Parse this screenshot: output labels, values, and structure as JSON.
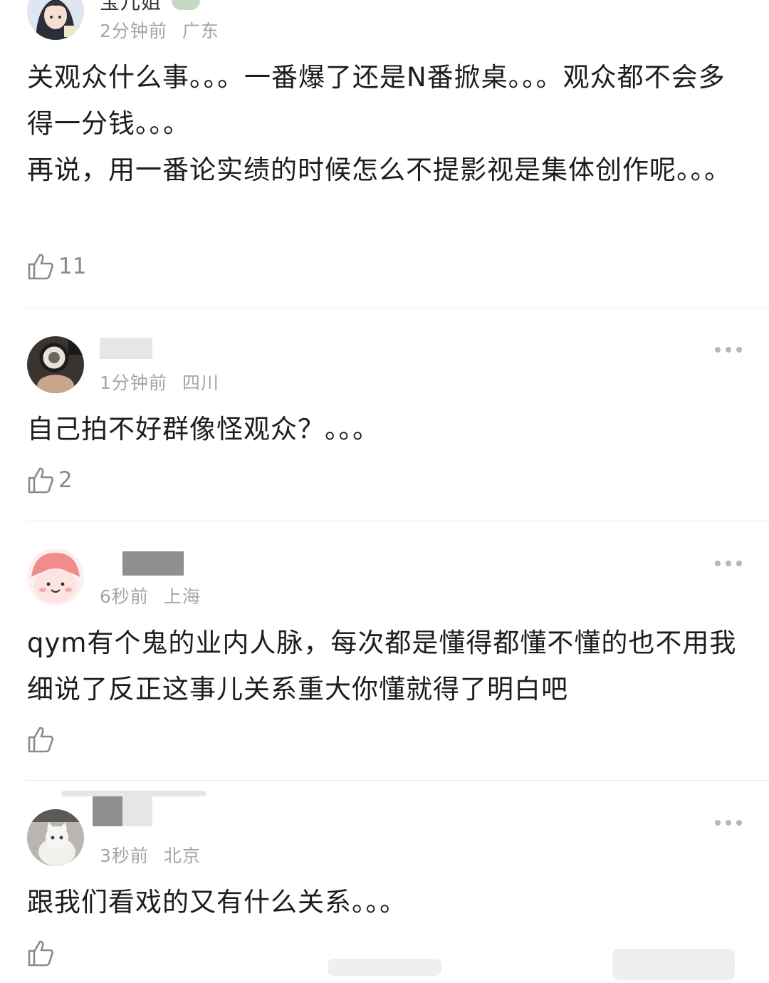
{
  "comments": [
    {
      "avatar": "anime-girl-avatar",
      "username": "宝儿姐",
      "time": "2分钟前",
      "location": "广东",
      "text": "关观众什么事。。。一番爆了还是N番掀桌。。。观众都不会多得一分钱。。。\n再说，用一番论实绩的时候怎么不提影视是集体创作呢。。。",
      "likes": "11"
    },
    {
      "avatar": "photo-avatar",
      "username": "",
      "time": "1分钟前",
      "location": "四川",
      "text": "自己拍不好群像怪观众？。。。",
      "likes": "2"
    },
    {
      "avatar": "cartoon-pink-avatar",
      "username": "",
      "time": "6秒前",
      "location": "上海",
      "text": "qym有个鬼的业内人脉，每次都是懂得都懂不懂的也不用我细说了反正这事儿关系重大你懂就得了明白吧",
      "likes": ""
    },
    {
      "avatar": "cat-photo-avatar",
      "username": "",
      "time": "3秒前",
      "location": "北京",
      "text": "跟我们看戏的又有什么关系。。。",
      "likes": ""
    }
  ],
  "icons": {
    "like": "thumbs-up-icon",
    "more": "more-options-icon"
  },
  "colors": {
    "text": "#1d1d1d",
    "meta": "#a5a5a5",
    "divider": "#ececec"
  }
}
